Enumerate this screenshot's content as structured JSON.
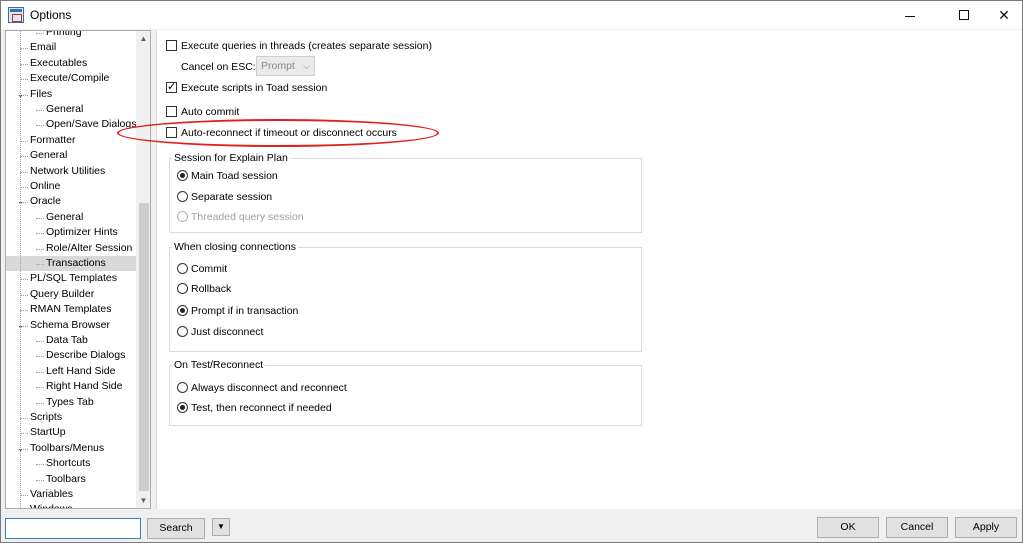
{
  "window": {
    "title": "Options",
    "minimize_icon": "minimize-icon",
    "maximize_icon": "maximize-icon",
    "close_glyph": "✕"
  },
  "tree": {
    "items": [
      {
        "label": "Printing",
        "level": 2
      },
      {
        "label": "Email",
        "level": 1
      },
      {
        "label": "Executables",
        "level": 1
      },
      {
        "label": "Execute/Compile",
        "level": 1
      },
      {
        "label": "Files",
        "level": 1,
        "expanded": true
      },
      {
        "label": "General",
        "level": 2
      },
      {
        "label": "Open/Save Dialogs",
        "level": 2
      },
      {
        "label": "Formatter",
        "level": 1
      },
      {
        "label": "General",
        "level": 1
      },
      {
        "label": "Network Utilities",
        "level": 1
      },
      {
        "label": "Online",
        "level": 1
      },
      {
        "label": "Oracle",
        "level": 1,
        "expanded": true
      },
      {
        "label": "General",
        "level": 2
      },
      {
        "label": "Optimizer Hints",
        "level": 2
      },
      {
        "label": "Role/Alter Session",
        "level": 2
      },
      {
        "label": "Transactions",
        "level": 2,
        "selected": true
      },
      {
        "label": "PL/SQL Templates",
        "level": 1
      },
      {
        "label": "Query Builder",
        "level": 1
      },
      {
        "label": "RMAN Templates",
        "level": 1
      },
      {
        "label": "Schema Browser",
        "level": 1,
        "expanded": true
      },
      {
        "label": "Data Tab",
        "level": 2
      },
      {
        "label": "Describe Dialogs",
        "level": 2
      },
      {
        "label": "Left Hand Side",
        "level": 2
      },
      {
        "label": "Right Hand Side",
        "level": 2
      },
      {
        "label": "Types Tab",
        "level": 2
      },
      {
        "label": "Scripts",
        "level": 1
      },
      {
        "label": "StartUp",
        "level": 1
      },
      {
        "label": "Toolbars/Menus",
        "level": 1,
        "expanded": true
      },
      {
        "label": "Shortcuts",
        "level": 2
      },
      {
        "label": "Toolbars",
        "level": 2
      },
      {
        "label": "Variables",
        "level": 1
      },
      {
        "label": "Windows",
        "level": 1
      }
    ]
  },
  "options": {
    "execute_threads": {
      "label": "Execute queries in threads (creates separate session)",
      "checked": false
    },
    "cancel_on_esc": {
      "label": "Cancel on ESC:",
      "value": "Prompt",
      "enabled": false
    },
    "execute_scripts": {
      "label": "Execute scripts in Toad session",
      "checked": true
    },
    "auto_commit": {
      "label": "Auto commit",
      "checked": false
    },
    "auto_reconnect": {
      "label": "Auto-reconnect if timeout or disconnect occurs",
      "checked": false,
      "highlight_color": "#e0201f"
    }
  },
  "explain_plan": {
    "title": "Session for Explain Plan",
    "options": [
      {
        "label": "Main Toad session",
        "checked": true,
        "enabled": true
      },
      {
        "label": "Separate session",
        "checked": false,
        "enabled": true
      },
      {
        "label": "Threaded query session",
        "checked": false,
        "enabled": false
      }
    ]
  },
  "closing": {
    "title": "When closing connections",
    "options": [
      {
        "label": "Commit",
        "checked": false
      },
      {
        "label": "Rollback",
        "checked": false
      },
      {
        "label": "Prompt if in transaction",
        "checked": true
      },
      {
        "label": "Just disconnect",
        "checked": false
      }
    ]
  },
  "reconnect": {
    "title": "On Test/Reconnect",
    "options": [
      {
        "label": "Always disconnect and reconnect",
        "checked": false
      },
      {
        "label": "Test, then reconnect if needed",
        "checked": true
      }
    ]
  },
  "bottom": {
    "search_value": "",
    "search_button": "Search",
    "ok": "OK",
    "cancel": "Cancel",
    "apply": "Apply"
  }
}
